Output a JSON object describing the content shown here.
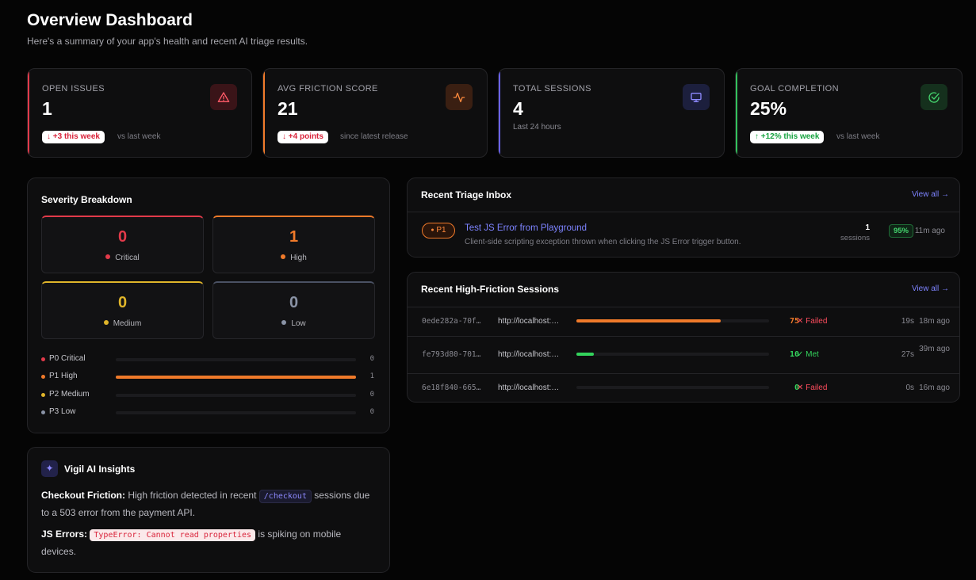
{
  "header": {
    "title": "Overview Dashboard",
    "subtitle": "Here's a summary of your app's health and recent AI triage results."
  },
  "stats": [
    {
      "label": "OPEN ISSUES",
      "value": "1",
      "badge": "↓ +3 this week",
      "note": "vs last week",
      "accent": "#e23a4a",
      "icon": "alert-triangle-icon"
    },
    {
      "label": "AVG FRICTION SCORE",
      "value": "21",
      "badge": "↓ +4 points",
      "note": "since latest release",
      "accent": "#f07a2a",
      "icon": "activity-icon"
    },
    {
      "label": "TOTAL SESSIONS",
      "value": "4",
      "sub": "Last 24 hours",
      "accent": "#6a62f5",
      "icon": "monitor-icon"
    },
    {
      "label": "GOAL COMPLETION",
      "value": "25%",
      "badge": "↑ +12% this week",
      "note": "vs last week",
      "accent": "#33c25c",
      "icon": "check-circle-icon"
    }
  ],
  "severity": {
    "title": "Severity Breakdown",
    "cards": [
      {
        "count": "0",
        "label": "Critical",
        "color": "#e23a4a"
      },
      {
        "count": "1",
        "label": "High",
        "color": "#f07a2a"
      },
      {
        "count": "0",
        "label": "Medium",
        "color": "#e0b52a"
      },
      {
        "count": "0",
        "label": "Low",
        "color": "#8a93a6"
      }
    ],
    "priorities": [
      {
        "label": "P0 Critical",
        "count": "0",
        "fraction": 0,
        "color": "#e23a4a"
      },
      {
        "label": "P1 High",
        "count": "1",
        "fraction": 1,
        "color": "#f07a2a"
      },
      {
        "label": "P2 Medium",
        "count": "0",
        "fraction": 0,
        "color": "#e0b52a"
      },
      {
        "label": "P3 Low",
        "count": "0",
        "fraction": 0,
        "color": "#8a93a6"
      }
    ]
  },
  "insights": {
    "title": "Vigil AI Insights",
    "p1_label": "Checkout Friction:",
    "p1_text1": " High friction detected in recent ",
    "p1_code": "/checkout",
    "p1_text2": " sessions due to a 503 error from the payment API.",
    "p2_label": "JS Errors:",
    "p2_code": "TypeError: Cannot read properties",
    "p2_text": " is spiking on mobile devices."
  },
  "triage": {
    "title": "Recent Triage Inbox",
    "view_all": "View all →",
    "item": {
      "priority": "P1",
      "title": "Test JS Error from Playground",
      "desc": "Client-side scripting exception thrown when clicking the JS Error trigger button.",
      "sessions_count": "1",
      "sessions_label": "sessions",
      "confidence": "95%",
      "ago": "11m ago"
    }
  },
  "sessions": {
    "title": "Recent High-Friction Sessions",
    "view_all": "View all →",
    "rows": [
      {
        "id": "0ede282a-70f…",
        "url": "http://localhost:…",
        "score": "75",
        "fraction": 0.75,
        "color": "#f07a2a",
        "status": "✕ Failed",
        "status_color": "#ff4d5e",
        "duration": "19s",
        "ago": "18m ago"
      },
      {
        "id": "fe793d80-701…",
        "url": "http://localhost:…",
        "score": "10",
        "fraction": 0.09,
        "color": "#33d35c",
        "status": "✓ Met",
        "status_color": "#33d35c",
        "duration": "27s",
        "ago": "39m ago"
      },
      {
        "id": "6e18f840-665…",
        "url": "http://localhost:…",
        "score": "0",
        "fraction": 0,
        "color": "#33d35c",
        "status": "✕ Failed",
        "status_color": "#ff4d5e",
        "duration": "0s",
        "ago": "16m ago"
      }
    ]
  }
}
